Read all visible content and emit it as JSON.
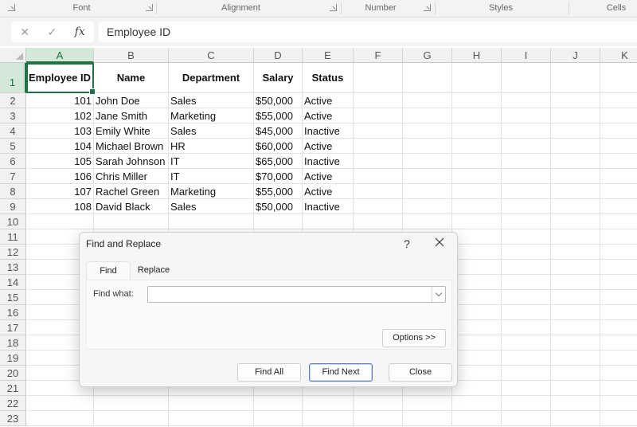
{
  "ribbon": {
    "groups": [
      "Font",
      "Alignment",
      "Number",
      "Styles",
      "Cells"
    ]
  },
  "formula_bar": {
    "cancel_icon": "✕",
    "enter_icon": "✓",
    "fx_label": "fx",
    "value": "Employee ID"
  },
  "sheet": {
    "columns": [
      "A",
      "B",
      "C",
      "D",
      "E",
      "F",
      "G",
      "H",
      "I",
      "J",
      "K"
    ],
    "rows": [
      "1",
      "2",
      "3",
      "4",
      "5",
      "6",
      "7",
      "8",
      "9",
      "10",
      "11",
      "12",
      "13",
      "14",
      "15",
      "16",
      "17",
      "18",
      "19",
      "20",
      "21",
      "22",
      "23"
    ],
    "header": [
      "Employee ID",
      "Name",
      "Department",
      "Salary",
      "Status"
    ],
    "data": [
      [
        "101",
        "John Doe",
        "Sales",
        "$50,000",
        "Active"
      ],
      [
        "102",
        "Jane Smith",
        "Marketing",
        "$55,000",
        "Active"
      ],
      [
        "103",
        "Emily White",
        "Sales",
        "$45,000",
        "Inactive"
      ],
      [
        "104",
        "Michael Brown",
        "HR",
        "$60,000",
        "Active"
      ],
      [
        "105",
        "Sarah Johnson",
        "IT",
        "$65,000",
        "Inactive"
      ],
      [
        "106",
        "Chris Miller",
        "IT",
        "$70,000",
        "Active"
      ],
      [
        "107",
        "Rachel Green",
        "Marketing",
        "$55,000",
        "Active"
      ],
      [
        "108",
        "David Black",
        "Sales",
        "$50,000",
        "Inactive"
      ]
    ],
    "accent_color": "#217346"
  },
  "dialog": {
    "title": "Find and Replace",
    "help": "?",
    "tabs": [
      "Find",
      "Replace"
    ],
    "find_what_label": "Find what:",
    "find_what_value": "",
    "options_label": "Options >>",
    "find_all_label": "Find All",
    "find_next_label": "Find Next",
    "close_label": "Close"
  }
}
